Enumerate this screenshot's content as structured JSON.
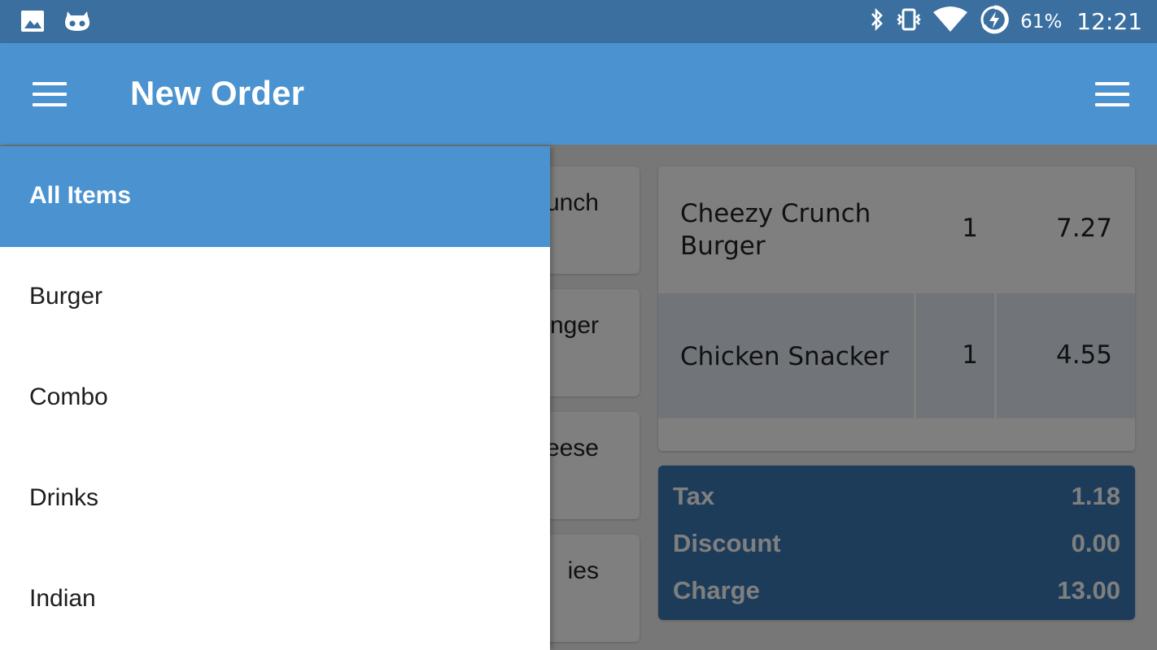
{
  "status_bar": {
    "battery_percent": "61%",
    "time": "12:21",
    "color": "#3a6f9f",
    "icons": [
      "gallery-icon",
      "cyanogen-icon",
      "bluetooth-icon",
      "vibrate-icon",
      "wifi-icon",
      "battery-charging-icon"
    ]
  },
  "app_bar": {
    "title": "New Order",
    "color": "#4b93d0",
    "left_icon": "menu-icon",
    "right_icon": "overflow-menu-icon"
  },
  "drawer": {
    "active_color": "#4b93d0",
    "items": [
      {
        "label": "All Items",
        "active": true
      },
      {
        "label": "Burger",
        "active": false
      },
      {
        "label": "Combo",
        "active": false
      },
      {
        "label": "Drinks",
        "active": false
      },
      {
        "label": "Indian",
        "active": false
      }
    ]
  },
  "products": [
    {
      "label_visible": "unch"
    },
    {
      "label_visible": "nger"
    },
    {
      "label_visible": "eese"
    },
    {
      "label_visible": "ies"
    }
  ],
  "order": {
    "items": [
      {
        "name_line1": "Cheezy Crunch",
        "name_line2": "Burger",
        "qty": "1",
        "price": "7.27"
      },
      {
        "name_line1": "Chicken Snacker",
        "name_line2": "",
        "qty": "1",
        "price": "4.55"
      }
    ]
  },
  "summary": {
    "color": "#3a78b4",
    "tax_label": "Tax",
    "tax_value": "1.18",
    "discount_label": "Discount",
    "discount_value": "0.00",
    "charge_label": "Charge",
    "charge_value": "13.00"
  }
}
